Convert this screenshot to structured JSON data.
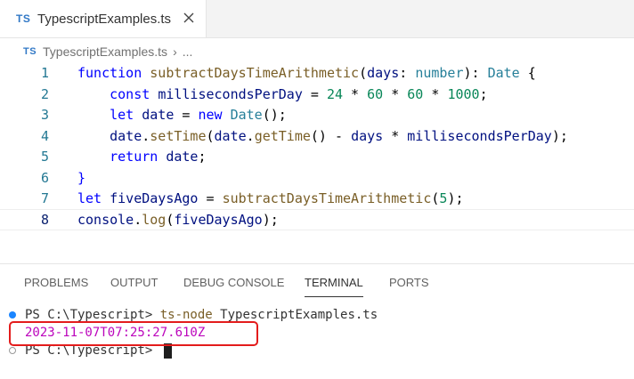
{
  "editor_tab": {
    "badge": "TS",
    "title": "TypescriptExamples.ts",
    "close_icon": "close-icon"
  },
  "breadcrumb": {
    "badge": "TS",
    "file": "TypescriptExamples.ts",
    "separator": "›",
    "more": "..."
  },
  "code_lines": [
    {
      "n": "1",
      "tokens": [
        {
          "t": "function",
          "c": "kw"
        },
        {
          "t": " ",
          "c": "pun"
        },
        {
          "t": "subtractDaysTimeArithmetic",
          "c": "fn"
        },
        {
          "t": "(",
          "c": "pun"
        },
        {
          "t": "days",
          "c": "var"
        },
        {
          "t": ": ",
          "c": "pun"
        },
        {
          "t": "number",
          "c": "typ"
        },
        {
          "t": "): ",
          "c": "pun"
        },
        {
          "t": "Date",
          "c": "typ"
        },
        {
          "t": " {",
          "c": "pun"
        }
      ]
    },
    {
      "n": "2",
      "tokens": [
        {
          "t": "    ",
          "c": "pun"
        },
        {
          "t": "const",
          "c": "kw"
        },
        {
          "t": " ",
          "c": "pun"
        },
        {
          "t": "millisecondsPerDay",
          "c": "var"
        },
        {
          "t": " = ",
          "c": "pun"
        },
        {
          "t": "24",
          "c": "num"
        },
        {
          "t": " * ",
          "c": "pun"
        },
        {
          "t": "60",
          "c": "num"
        },
        {
          "t": " * ",
          "c": "pun"
        },
        {
          "t": "60",
          "c": "num"
        },
        {
          "t": " * ",
          "c": "pun"
        },
        {
          "t": "1000",
          "c": "num"
        },
        {
          "t": ";",
          "c": "pun"
        }
      ]
    },
    {
      "n": "3",
      "tokens": [
        {
          "t": "    ",
          "c": "pun"
        },
        {
          "t": "let",
          "c": "kw"
        },
        {
          "t": " ",
          "c": "pun"
        },
        {
          "t": "date",
          "c": "var"
        },
        {
          "t": " = ",
          "c": "pun"
        },
        {
          "t": "new",
          "c": "kw"
        },
        {
          "t": " ",
          "c": "pun"
        },
        {
          "t": "Date",
          "c": "typ"
        },
        {
          "t": "();",
          "c": "pun"
        }
      ]
    },
    {
      "n": "4",
      "tokens": [
        {
          "t": "    ",
          "c": "pun"
        },
        {
          "t": "date",
          "c": "var"
        },
        {
          "t": ".",
          "c": "pun"
        },
        {
          "t": "setTime",
          "c": "fn"
        },
        {
          "t": "(",
          "c": "pun"
        },
        {
          "t": "date",
          "c": "var"
        },
        {
          "t": ".",
          "c": "pun"
        },
        {
          "t": "getTime",
          "c": "fn"
        },
        {
          "t": "() - ",
          "c": "pun"
        },
        {
          "t": "days",
          "c": "var"
        },
        {
          "t": " * ",
          "c": "pun"
        },
        {
          "t": "millisecondsPerDay",
          "c": "var"
        },
        {
          "t": ");",
          "c": "pun"
        }
      ]
    },
    {
      "n": "5",
      "tokens": [
        {
          "t": "    ",
          "c": "pun"
        },
        {
          "t": "return",
          "c": "kw"
        },
        {
          "t": " ",
          "c": "pun"
        },
        {
          "t": "date",
          "c": "var"
        },
        {
          "t": ";",
          "c": "pun"
        }
      ]
    },
    {
      "n": "6",
      "tokens": [
        {
          "t": "}",
          "c": "kw"
        }
      ]
    },
    {
      "n": "7",
      "tokens": [
        {
          "t": "let",
          "c": "kw"
        },
        {
          "t": " ",
          "c": "pun"
        },
        {
          "t": "fiveDaysAgo",
          "c": "var"
        },
        {
          "t": " = ",
          "c": "pun"
        },
        {
          "t": "subtractDaysTimeArithmetic",
          "c": "fn"
        },
        {
          "t": "(",
          "c": "pun"
        },
        {
          "t": "5",
          "c": "num"
        },
        {
          "t": ");",
          "c": "pun"
        }
      ]
    },
    {
      "n": "8",
      "tokens": [
        {
          "t": "console",
          "c": "var"
        },
        {
          "t": ".",
          "c": "pun"
        },
        {
          "t": "log",
          "c": "fn"
        },
        {
          "t": "(",
          "c": "pun"
        },
        {
          "t": "fiveDaysAgo",
          "c": "var"
        },
        {
          "t": ");",
          "c": "pun"
        }
      ]
    }
  ],
  "panel_tabs": [
    "PROBLEMS",
    "OUTPUT",
    "DEBUG CONSOLE",
    "TERMINAL",
    "PORTS"
  ],
  "active_panel_tab": "TERMINAL",
  "terminal": {
    "line1_prompt": "PS C:\\Typescript> ",
    "line1_command": "ts-node",
    "line1_args": " TypescriptExamples.ts",
    "output": "2023-11-07T07:25:27.610Z",
    "line3_prompt": "PS C:\\Typescript> "
  },
  "colors": {
    "ts_badge": "#3178c6",
    "output_text": "#bc05bc",
    "highlight_box": "#e31c1c",
    "status_dot": "#1a85ff"
  }
}
